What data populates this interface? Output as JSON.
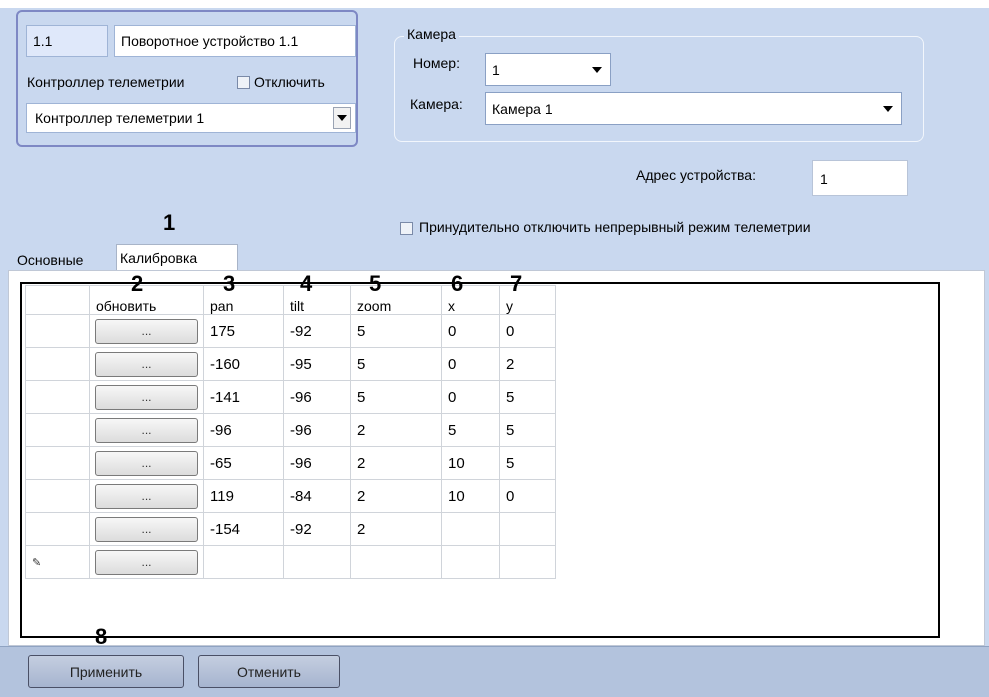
{
  "device": {
    "id": "1.1",
    "name": "Поворотное устройство 1.1",
    "controller_label": "Контроллер телеметрии",
    "disable_label": "Отключить",
    "controller_value": "Контроллер телеметрии 1"
  },
  "camera": {
    "group_label": "Камера",
    "number_label": "Номер:",
    "number_value": "1",
    "camera_label": "Камера:",
    "camera_value": "Камера 1"
  },
  "address": {
    "label": "Адрес устройства:",
    "value": "1"
  },
  "force_disable_label": "Принудительно отключить непрерывный режим телеметрии",
  "tabs": [
    {
      "label": "Основные"
    },
    {
      "label": "Калибровка"
    }
  ],
  "callouts": [
    "1",
    "2",
    "3",
    "4",
    "5",
    "6",
    "7",
    "8"
  ],
  "grid": {
    "columns": [
      "",
      "обновить",
      "pan",
      "tilt",
      "zoom",
      "x",
      "y"
    ],
    "button_label": "...",
    "new_row_marker": "✎",
    "rows": [
      {
        "pan": "175",
        "tilt": "-92",
        "zoom": "5",
        "x": "0",
        "y": "0"
      },
      {
        "pan": "-160",
        "tilt": "-95",
        "zoom": "5",
        "x": "0",
        "y": "2"
      },
      {
        "pan": "-141",
        "tilt": "-96",
        "zoom": "5",
        "x": "0",
        "y": "5"
      },
      {
        "pan": "-96",
        "tilt": "-96",
        "zoom": "2",
        "x": "5",
        "y": "5"
      },
      {
        "pan": "-65",
        "tilt": "-96",
        "zoom": "2",
        "x": "10",
        "y": "5"
      },
      {
        "pan": "119",
        "tilt": "-84",
        "zoom": "2",
        "x": "10",
        "y": "0"
      },
      {
        "pan": "-154",
        "tilt": "-92",
        "zoom": "2",
        "x": "",
        "y": ""
      },
      {
        "pan": "",
        "tilt": "",
        "zoom": "",
        "x": "",
        "y": ""
      }
    ]
  },
  "buttons": {
    "apply": "Применить",
    "cancel": "Отменить"
  }
}
